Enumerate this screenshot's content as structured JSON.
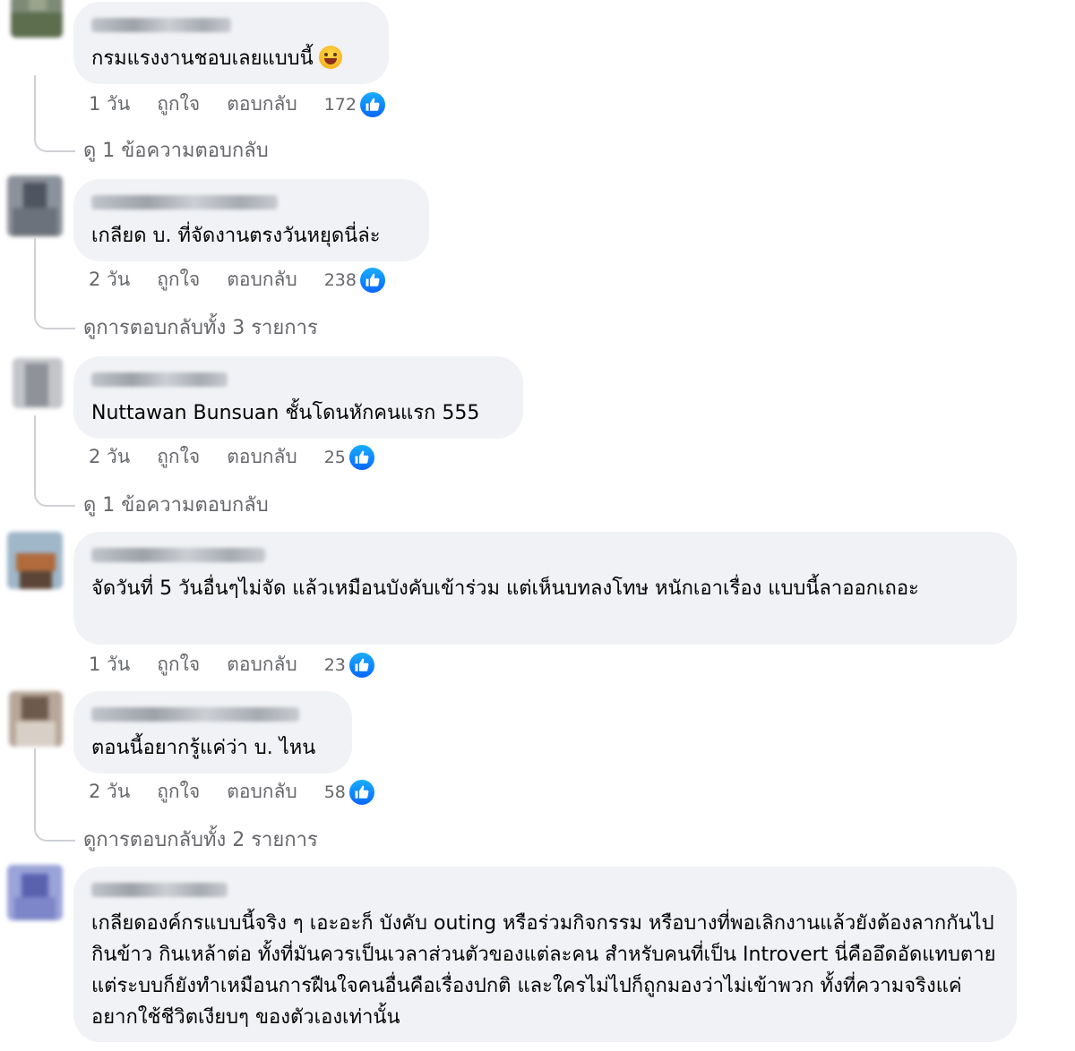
{
  "colors": {
    "bubble_bg": "#f0f2f5",
    "meta_text": "#65676b",
    "like_blue": "#0866ff"
  },
  "comments": [
    {
      "text": "กรมแรงงานชอบเลยแบบนี้",
      "emoji": "laughing-emoji",
      "time": "1 วัน",
      "like_label": "ถูกใจ",
      "reply_label": "ตอบกลับ",
      "reactions": "172",
      "replies_link": "ดู 1 ข้อความตอบกลับ"
    },
    {
      "text": "เกลียด บ. ที่จัดงานตรงวันหยุดนี่ล่ะ",
      "time": "2 วัน",
      "like_label": "ถูกใจ",
      "reply_label": "ตอบกลับ",
      "reactions": "238",
      "replies_link": "ดูการตอบกลับทั้ง 3 รายการ"
    },
    {
      "text": "Nuttawan Bunsuan ชั้นโดนหักคนแรก 555",
      "time": "2 วัน",
      "like_label": "ถูกใจ",
      "reply_label": "ตอบกลับ",
      "reactions": "25",
      "replies_link": "ดู 1 ข้อความตอบกลับ"
    },
    {
      "text": "จัดวันที่ 5 วันอื่นๆไม่จัด แล้วเหมือนบังคับเข้าร่วม แต่เห็นบทลงโทษ หนักเอาเรื่อง แบบนี้ลาออกเถอะ",
      "time": "1 วัน",
      "like_label": "ถูกใจ",
      "reply_label": "ตอบกลับ",
      "reactions": "23"
    },
    {
      "text": "ตอนนี้อยากรู้แค่ว่า บ. ไหน",
      "time": "2 วัน",
      "like_label": "ถูกใจ",
      "reply_label": "ตอบกลับ",
      "reactions": "58",
      "replies_link": "ดูการตอบกลับทั้ง 2 รายการ"
    },
    {
      "text": "เกลียดองค์กรแบบนี้จริง ๆ เอะอะก็ บังคับ outing หรือร่วมกิจกรรม หรือบางที่พอเลิกงานแล้วยังต้องลากกันไปกินข้าว กินเหล้าต่อ ทั้งที่มันควรเป็นเวลาส่วนตัวของแต่ละคน สำหรับคนที่เป็น Introvert นี่คืออึดอัดแทบตาย แต่ระบบก็ยังทำเหมือนการฝืนใจคนอื่นคือเรื่องปกติ และใครไม่ไปก็ถูกมองว่าไม่เข้าพวก ทั้งที่ความจริงแค่อยากใช้ชีวิตเงียบๆ ของตัวเองเท่านั้น"
    }
  ]
}
